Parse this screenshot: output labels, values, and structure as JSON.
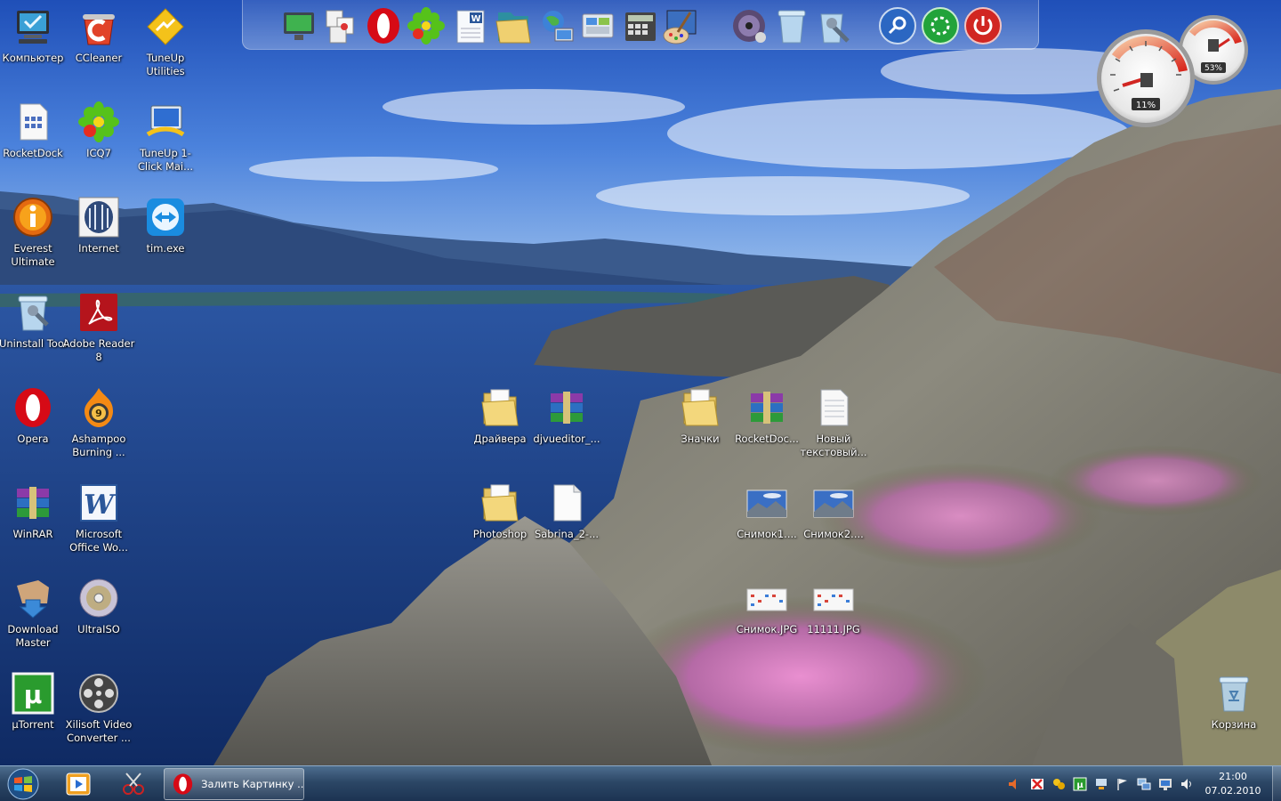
{
  "desktop": {
    "icons": [
      {
        "label": "Компьютер",
        "icon": "computer-icon"
      },
      {
        "label": "CCleaner",
        "icon": "ccleaner-icon"
      },
      {
        "label": "TuneUp Utilities",
        "icon": "tuneup-icon"
      },
      {
        "label": "RocketDock",
        "icon": "rocketdock-file-icon"
      },
      {
        "label": "ICQ7",
        "icon": "icq-flower-icon"
      },
      {
        "label": "TuneUp 1-Click Mai...",
        "icon": "tuneup-monitor-icon"
      },
      {
        "label": "Everest Ultimate",
        "icon": "everest-info-icon"
      },
      {
        "label": "Internet",
        "icon": "internet-icon"
      },
      {
        "label": "tim.exe",
        "icon": "teamviewer-icon"
      },
      {
        "label": "Uninstall Tool",
        "icon": "uninstall-tool-icon"
      },
      {
        "label": "Adobe Reader 8",
        "icon": "adobe-reader-icon"
      },
      {
        "label": "Opera",
        "icon": "opera-icon"
      },
      {
        "label": "Ashampoo Burning ...",
        "icon": "ashampoo-icon"
      },
      {
        "label": "WinRAR",
        "icon": "winrar-icon"
      },
      {
        "label": "Microsoft Office Wo...",
        "icon": "word-icon"
      },
      {
        "label": "Download Master",
        "icon": "download-master-icon"
      },
      {
        "label": "UltraISO",
        "icon": "ultraiso-disc-icon"
      },
      {
        "label": "µTorrent",
        "icon": "utorrent-icon"
      },
      {
        "label": "Xilisoft Video Converter ...",
        "icon": "film-reel-icon"
      },
      {
        "label": "Драйвера",
        "icon": "folder-icon"
      },
      {
        "label": "djvueditor_...",
        "icon": "rar-archive-icon"
      },
      {
        "label": "Значки",
        "icon": "folder-icon"
      },
      {
        "label": "RocketDoc...",
        "icon": "rar-archive-icon"
      },
      {
        "label": "Новый текстовый...",
        "icon": "text-document-icon"
      },
      {
        "label": "Photoshop",
        "icon": "folder-icon"
      },
      {
        "label": "Sabrina_2-...",
        "icon": "blank-document-icon"
      },
      {
        "label": "Снимок1....",
        "icon": "image-thumbnail-icon"
      },
      {
        "label": "Снимок2....",
        "icon": "image-thumbnail-icon"
      },
      {
        "label": "Снимок.JPG",
        "icon": "screenshot-thumbnail-icon"
      },
      {
        "label": "11111.JPG",
        "icon": "screenshot-thumbnail-icon"
      },
      {
        "label": "Корзина",
        "icon": "recycle-bin-icon"
      }
    ]
  },
  "dock": {
    "items": [
      "desktop-monitor-icon",
      "web-tools-icon",
      "opera-icon",
      "icq-flower-icon",
      "word-document-icon",
      "folder-icon",
      "network-globe-icon",
      "control-panel-icon",
      "calculator-icon",
      "paint-icon",
      "media-player-icon",
      "recycle-bin-icon",
      "tools-icon",
      "search-icon",
      "restart-icon",
      "power-icon"
    ]
  },
  "gadget": {
    "cpu_percent": "11%",
    "memory_percent": "53%"
  },
  "taskbar": {
    "task_label": "Залить Картинку ...",
    "clock_time": "21:00",
    "clock_date": "07.02.2010",
    "tray_icons": [
      "volume-icon",
      "antivirus-icon",
      "messenger-icon",
      "app-icon",
      "network-share-icon",
      "flag-icon",
      "network-icon",
      "display-icon",
      "speaker-icon"
    ]
  },
  "colors": {
    "taskbar": "#2c4766",
    "sky": "#2d63c8",
    "lake": "#1a3c86"
  }
}
